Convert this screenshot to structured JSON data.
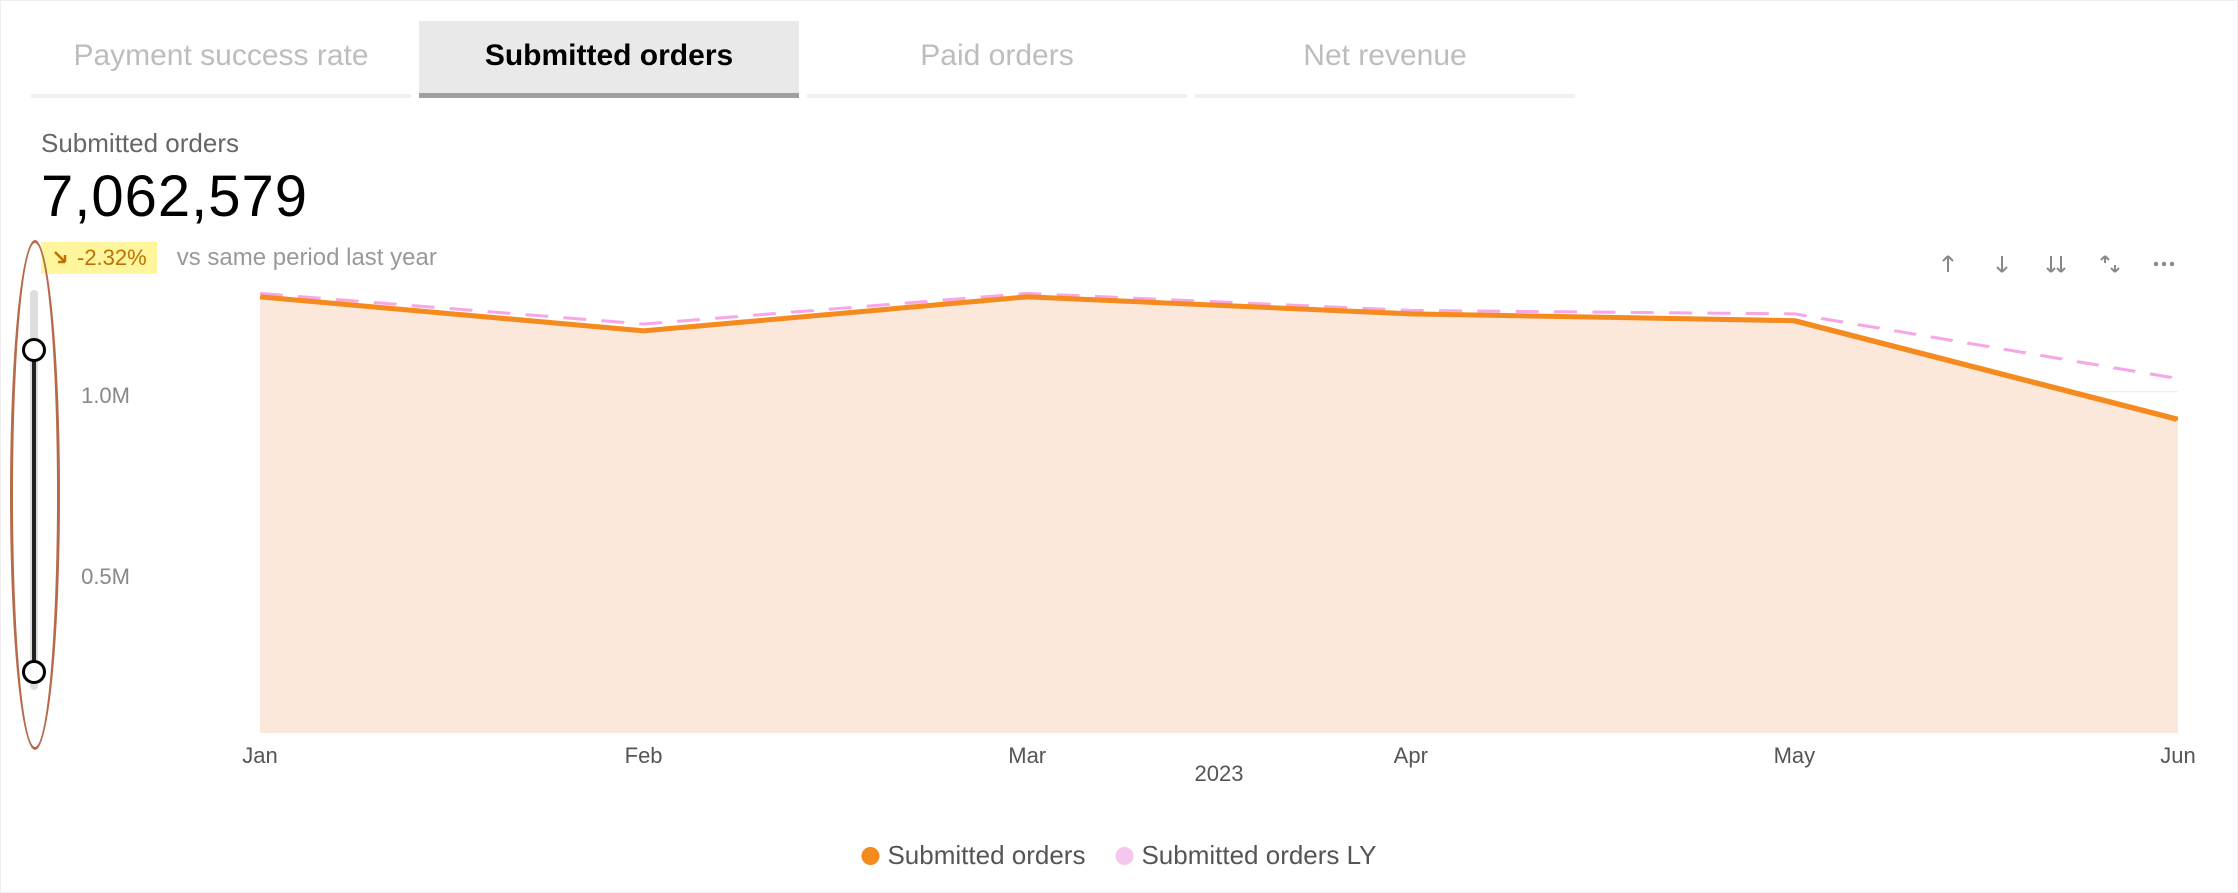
{
  "tabs": [
    {
      "label": "Payment success rate",
      "active": false
    },
    {
      "label": "Submitted orders",
      "active": true
    },
    {
      "label": "Paid orders",
      "active": false
    },
    {
      "label": "Net revenue",
      "active": false
    }
  ],
  "metric": {
    "title": "Submitted orders",
    "value": "7,062,579",
    "delta": "-2.32%",
    "delta_direction": "down",
    "delta_context": "vs same period last year"
  },
  "toolbar": {
    "icons": [
      "sort-asc",
      "sort-desc",
      "drilldown",
      "expand",
      "more"
    ]
  },
  "legend": {
    "series1": {
      "label": "Submitted orders",
      "color": "#f58b1f"
    },
    "series2": {
      "label": "Submitted orders LY",
      "color": "#f6c7ee"
    }
  },
  "axis": {
    "y_ticks": [
      "1.0M",
      "0.5M"
    ],
    "x_ticks": [
      "Jan",
      "Feb",
      "Mar",
      "Apr",
      "May",
      "Jun"
    ],
    "x_year": "2023"
  },
  "colors": {
    "series1_line": "#f58b1f",
    "series1_fill": "#fce8db",
    "series2_line": "#f6a8e6"
  },
  "chart_data": {
    "type": "line",
    "title": "Submitted orders",
    "xlabel": "2023",
    "ylabel": "",
    "ylim": [
      0,
      1300000
    ],
    "categories": [
      "Jan",
      "Feb",
      "Mar",
      "Apr",
      "May",
      "Jun"
    ],
    "series": [
      {
        "name": "Submitted orders",
        "values": [
          1280000,
          1180000,
          1280000,
          1230000,
          1210000,
          920000
        ]
      },
      {
        "name": "Submitted orders LY",
        "values": [
          1290000,
          1200000,
          1290000,
          1240000,
          1230000,
          1040000
        ]
      }
    ]
  }
}
